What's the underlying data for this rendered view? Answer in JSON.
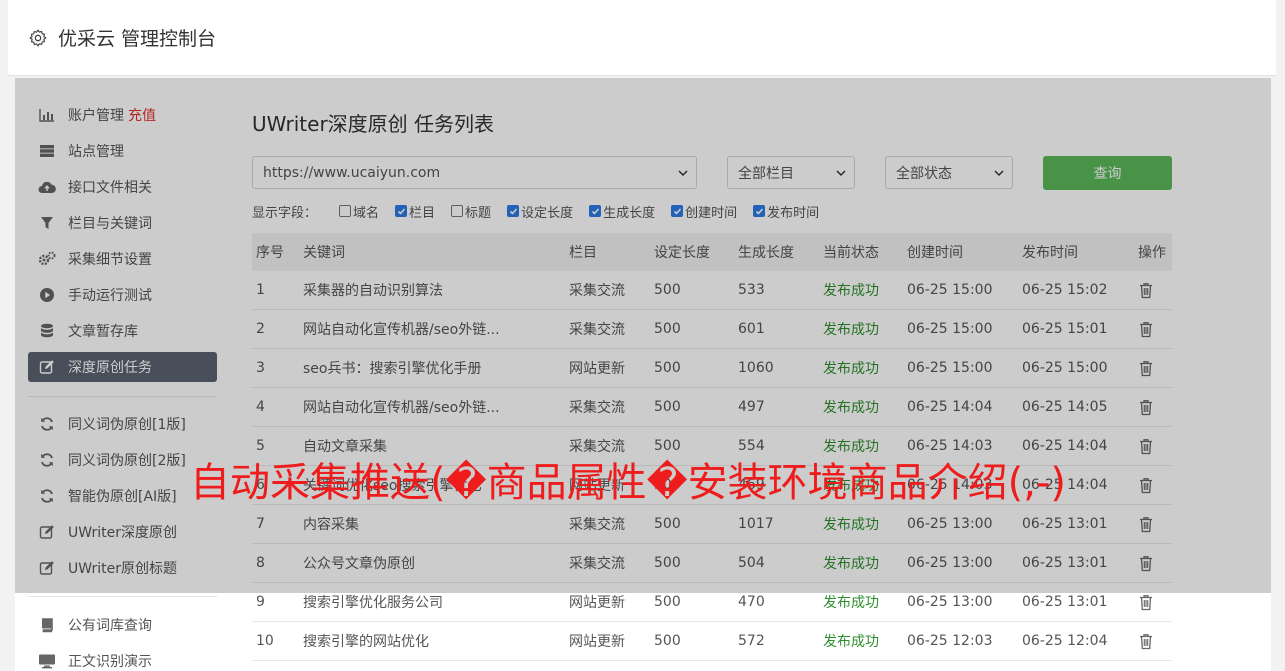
{
  "header": {
    "title": "优采云 管理控制台"
  },
  "sidebar": {
    "items": [
      {
        "label": "账户管理",
        "icon": "bar-chart-icon",
        "extra": "充值"
      },
      {
        "label": "站点管理",
        "icon": "server-icon"
      },
      {
        "label": "接口文件相关",
        "icon": "cloud-upload-icon"
      },
      {
        "label": "栏目与关键词",
        "icon": "filter-icon"
      },
      {
        "label": "采集细节设置",
        "icon": "gears-icon"
      },
      {
        "label": "手动运行测试",
        "icon": "play-circle-icon"
      },
      {
        "label": "文章暂存库",
        "icon": "database-icon"
      },
      {
        "label": "深度原创任务",
        "icon": "edit-icon",
        "active": true
      },
      {
        "label": "同义词伪原创[1版]",
        "icon": "refresh-icon"
      },
      {
        "label": "同义词伪原创[2版]",
        "icon": "refresh-icon"
      },
      {
        "label": "智能伪原创[AI版]",
        "icon": "refresh-icon"
      },
      {
        "label": "UWriter深度原创",
        "icon": "edit-icon"
      },
      {
        "label": "UWriter原创标题",
        "icon": "edit-icon"
      },
      {
        "label": "公有词库查询",
        "icon": "book-icon"
      },
      {
        "label": "正文识别演示",
        "icon": "monitor-icon"
      }
    ]
  },
  "main": {
    "title": "UWriter深度原创 任务列表",
    "filters": {
      "site": "https://www.ucaiyun.com",
      "column": "全部栏目",
      "status": "全部状态",
      "query_label": "查询"
    },
    "fields": {
      "label": "显示字段：",
      "options": [
        {
          "label": "域名",
          "checked": false
        },
        {
          "label": "栏目",
          "checked": true
        },
        {
          "label": "标题",
          "checked": false
        },
        {
          "label": "设定长度",
          "checked": true
        },
        {
          "label": "生成长度",
          "checked": true
        },
        {
          "label": "创建时间",
          "checked": true
        },
        {
          "label": "发布时间",
          "checked": true
        }
      ]
    },
    "table": {
      "headers": [
        "序号",
        "关键词",
        "栏目",
        "设定长度",
        "生成长度",
        "当前状态",
        "创建时间",
        "发布时间",
        "操作"
      ],
      "rows": [
        [
          "1",
          "采集器的自动识别算法",
          "采集交流",
          "500",
          "533",
          "发布成功",
          "06-25 15:00",
          "06-25 15:02"
        ],
        [
          "2",
          "网站自动化宣传机器/seo外链...",
          "采集交流",
          "500",
          "601",
          "发布成功",
          "06-25 15:00",
          "06-25 15:01"
        ],
        [
          "3",
          "seo兵书：搜索引擎优化手册",
          "网站更新",
          "500",
          "1060",
          "发布成功",
          "06-25 15:00",
          "06-25 15:00"
        ],
        [
          "4",
          "网站自动化宣传机器/seo外链...",
          "采集交流",
          "500",
          "497",
          "发布成功",
          "06-25 14:04",
          "06-25 14:05"
        ],
        [
          "5",
          "自动文章采集",
          "采集交流",
          "500",
          "554",
          "发布成功",
          "06-25 14:03",
          "06-25 14:04"
        ],
        [
          "6",
          "关键词优化seo搜索引擎优化",
          "网站更新",
          "500",
          "469",
          "发布成功",
          "06-25 14:03",
          "06-25 14:04"
        ],
        [
          "7",
          "内容采集",
          "采集交流",
          "500",
          "1017",
          "发布成功",
          "06-25 13:00",
          "06-25 13:01"
        ],
        [
          "8",
          "公众号文章伪原创",
          "采集交流",
          "500",
          "504",
          "发布成功",
          "06-25 13:00",
          "06-25 13:01"
        ],
        [
          "9",
          "搜索引擎优化服务公司",
          "网站更新",
          "500",
          "470",
          "发布成功",
          "06-25 13:00",
          "06-25 13:01"
        ],
        [
          "10",
          "搜索引擎的网站优化",
          "网站更新",
          "500",
          "572",
          "发布成功",
          "06-25 12:03",
          "06-25 12:04"
        ]
      ]
    }
  },
  "banner": {
    "text": "自动采集推送(�商品属性�安装环境商品介绍(,-)"
  },
  "colors": {
    "accent": "#5cb85c",
    "danger": "#e0312b",
    "success": "#2f8f2f",
    "active_nav": "#5a6372"
  }
}
